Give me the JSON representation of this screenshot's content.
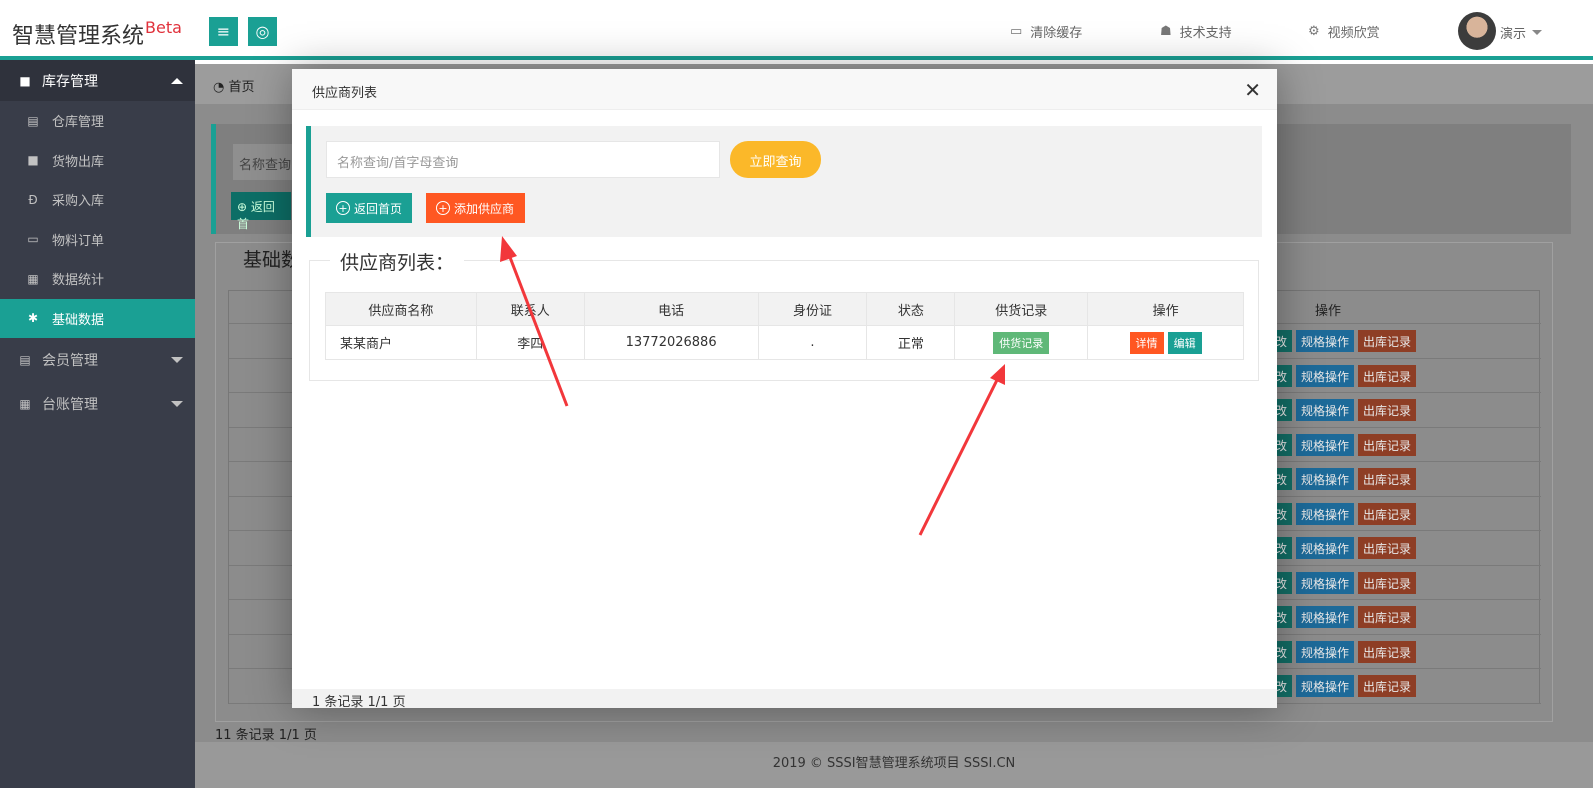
{
  "header": {
    "logo": "智慧管理系统",
    "logo_badge": "Beta",
    "nav": [
      {
        "label": "清除缓存",
        "icon": "monitor-icon"
      },
      {
        "label": "技术支持",
        "icon": "users-icon"
      },
      {
        "label": "视频欣赏",
        "icon": "gears-icon"
      }
    ],
    "user": "演示"
  },
  "sidebar": {
    "section": "库存管理",
    "items": [
      {
        "label": "仓库管理",
        "icon": "doc-icon",
        "glyph": "▤"
      },
      {
        "label": "货物出库",
        "icon": "folder-icon",
        "glyph": "■"
      },
      {
        "label": "采购入库",
        "icon": "currency-icon",
        "glyph": "Đ"
      },
      {
        "label": "物料订单",
        "icon": "chat-icon",
        "glyph": "▭"
      },
      {
        "label": "数据统计",
        "icon": "grid-icon",
        "glyph": "▦"
      },
      {
        "label": "基础数据",
        "icon": "gear-icon",
        "glyph": "✱"
      }
    ],
    "groups": [
      {
        "label": "会员管理",
        "icon": "card-icon",
        "glyph": "▤"
      },
      {
        "label": "台账管理",
        "icon": "grid-icon",
        "glyph": "▦"
      }
    ]
  },
  "background": {
    "tab_home": "首页",
    "search_placeholder": "名称查询",
    "back_button": "返回首",
    "fieldset_title": "基础数",
    "ops_header": "操作",
    "op_edit": "改",
    "op_spec": "规格操作",
    "op_out": "出库记录",
    "records": "11 条记录 1/1 页"
  },
  "footer": "2019 ©  SSSI智慧管理系统项目  SSSI.CN",
  "modal": {
    "title": "供应商列表",
    "search_placeholder": "名称查询/首字母查询",
    "search_button": "立即查询",
    "home_button": "返回首页",
    "add_button": "添加供应商",
    "legend": "供应商列表：",
    "columns": [
      "供应商名称",
      "联系人",
      "电话",
      "身份证",
      "状态",
      "供货记录",
      "操作"
    ],
    "rows": [
      {
        "name": "某某商户",
        "contact": "李四",
        "phone": "13772026886",
        "id_card": ".",
        "status": "正常",
        "supply_btn": "供货记录",
        "detail_btn": "详情",
        "edit_btn": "编辑"
      }
    ],
    "footer": "1 条记录 1/1 页"
  },
  "colors": {
    "accent": "#1aa094",
    "orange": "#ff5722",
    "yellow": "#fbb829",
    "green": "#5fb878",
    "arrow": "#f2373b"
  }
}
